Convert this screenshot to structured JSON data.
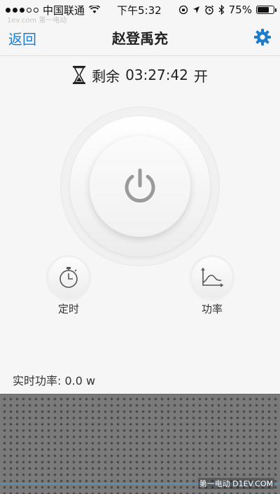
{
  "status_bar": {
    "carrier": "中国联通",
    "time": "下午5:32",
    "battery": "75%",
    "battery_level": 0.75
  },
  "watermark_top": "1ev.com 第一电动",
  "nav": {
    "back_label": "返回",
    "title": "赵登禹充"
  },
  "timer": {
    "prefix": "剩余",
    "countdown": "03:27:42",
    "state": "开"
  },
  "controls": {
    "timer_label": "定时",
    "power_label": "功率"
  },
  "realtime": {
    "label": "实时功率:",
    "value": "0.0",
    "unit": "w"
  },
  "watermark_bottom": "第一电动 D1EV.COM",
  "colors": {
    "accent": "#1e7ccc",
    "icon_gray": "#9a9a9a",
    "grille": "#7a7a7a"
  },
  "icons": [
    "signal-icon",
    "wifi-icon",
    "orientation-lock-icon",
    "location-icon",
    "alarm-icon",
    "bluetooth-icon",
    "battery-icon",
    "gear-icon",
    "hourglass-icon",
    "power-icon",
    "stopwatch-icon",
    "chart-icon"
  ]
}
